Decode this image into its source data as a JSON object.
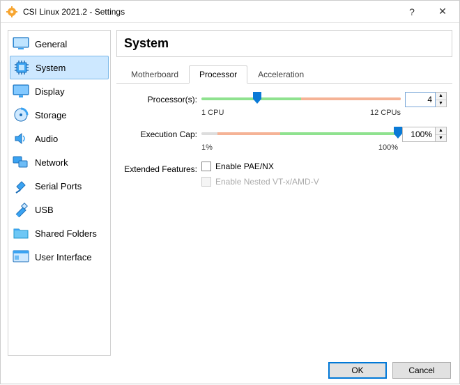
{
  "window": {
    "title": "CSI Linux 2021.2 - Settings",
    "help": "?",
    "close": "✕"
  },
  "sidebar": {
    "items": [
      {
        "label": "General"
      },
      {
        "label": "System"
      },
      {
        "label": "Display"
      },
      {
        "label": "Storage"
      },
      {
        "label": "Audio"
      },
      {
        "label": "Network"
      },
      {
        "label": "Serial Ports"
      },
      {
        "label": "USB"
      },
      {
        "label": "Shared Folders"
      },
      {
        "label": "User Interface"
      }
    ],
    "active_index": 1
  },
  "panel": {
    "title": "System",
    "tabs": [
      {
        "label": "Motherboard"
      },
      {
        "label": "Processor"
      },
      {
        "label": "Acceleration"
      }
    ],
    "active_tab": 1,
    "processors": {
      "label": "Processor(s):",
      "value": "4",
      "min_label": "1 CPU",
      "max_label": "12 CPUs",
      "min": 1,
      "max": 12,
      "green_end_pct": 50,
      "thumb_pct": 28
    },
    "exec_cap": {
      "label": "Execution Cap:",
      "value": "100%",
      "min_label": "1%",
      "max_label": "100%",
      "seg_gray_pct": 8,
      "seg_orange_pct": 32,
      "thumb_pct": 100
    },
    "extended": {
      "label": "Extended Features:",
      "pae": "Enable PAE/NX",
      "nested": "Enable Nested VT-x/AMD-V"
    }
  },
  "footer": {
    "ok": "OK",
    "cancel": "Cancel"
  }
}
